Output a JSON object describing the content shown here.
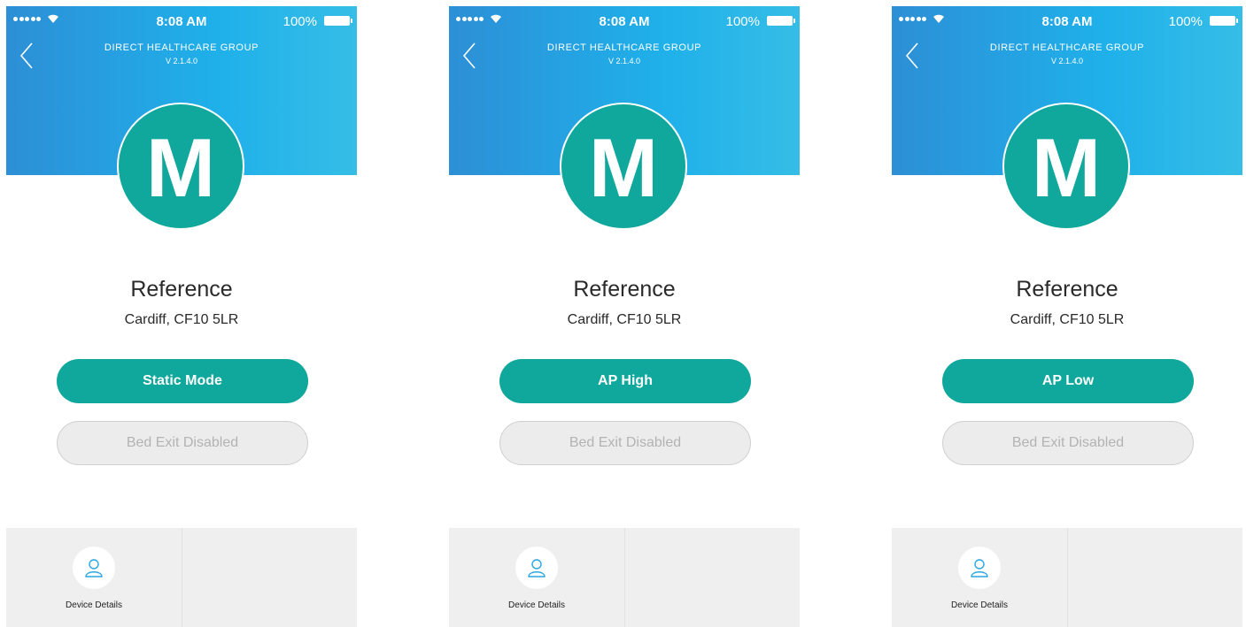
{
  "colors": {
    "header_start": "#2d8fd6",
    "header_end": "#35bde6",
    "accent": "#10a89c",
    "disabled_bg": "#ececec",
    "disabled_text": "#b3b3b3"
  },
  "screens": [
    {
      "status": {
        "time": "8:08 AM",
        "battery": "100%"
      },
      "header": {
        "org": "DIRECT HEALTHCARE GROUP",
        "version": "V 2.1.4.0",
        "back_icon": "chevron-left-icon"
      },
      "avatar": {
        "initial": "M"
      },
      "title": "Reference",
      "address": "Cardiff, CF10 5LR",
      "mode_button": "Static Mode",
      "bed_exit_button": "Bed Exit Disabled",
      "tabbar": {
        "device_details": "Device Details",
        "icon": "user-icon"
      }
    },
    {
      "status": {
        "time": "8:08 AM",
        "battery": "100%"
      },
      "header": {
        "org": "DIRECT HEALTHCARE GROUP",
        "version": "V 2.1.4.0",
        "back_icon": "chevron-left-icon"
      },
      "avatar": {
        "initial": "M"
      },
      "title": "Reference",
      "address": "Cardiff, CF10 5LR",
      "mode_button": "AP High",
      "bed_exit_button": "Bed Exit Disabled",
      "tabbar": {
        "device_details": "Device Details",
        "icon": "user-icon"
      }
    },
    {
      "status": {
        "time": "8:08 AM",
        "battery": "100%"
      },
      "header": {
        "org": "DIRECT HEALTHCARE GROUP",
        "version": "V 2.1.4.0",
        "back_icon": "chevron-left-icon"
      },
      "avatar": {
        "initial": "M"
      },
      "title": "Reference",
      "address": "Cardiff, CF10 5LR",
      "mode_button": "AP Low",
      "bed_exit_button": "Bed Exit Disabled",
      "tabbar": {
        "device_details": "Device Details",
        "icon": "user-icon"
      }
    }
  ]
}
